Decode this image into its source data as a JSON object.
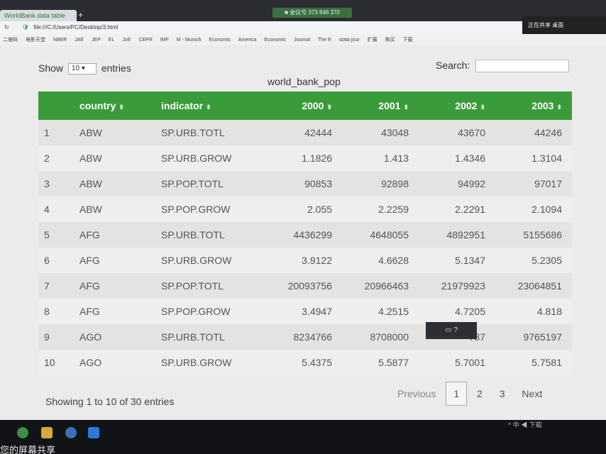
{
  "browser": {
    "tab_label": "WorldBank data table",
    "new_tab": "+",
    "monitor_text": "■ 会议号 373 846 370",
    "share_popup": "正在共享 桌面",
    "address": "file:///C:/Users/PC/Desktop/3.html",
    "bookmarks": [
      "二维码",
      "电影天堂",
      "NBER",
      "JAE",
      "JEP",
      "EL",
      "JoE",
      "CEPR",
      "IMF",
      "M - Munich",
      "Economic",
      "America",
      "Economic",
      "Journal",
      "The R",
      "stata jour",
      "扩展",
      "购买",
      "下载"
    ]
  },
  "table_page": {
    "show_label": "Show",
    "entries_select_value": "10",
    "entries_label": "entries",
    "search_label": "Search:",
    "search_value": "",
    "caption": "world_bank_pop",
    "columns": [
      "",
      "country",
      "indicator",
      "2000",
      "2001",
      "2002",
      "2003"
    ],
    "rows": [
      [
        "1",
        "ABW",
        "SP.URB.TOTL",
        "42444",
        "43048",
        "43670",
        "44246"
      ],
      [
        "2",
        "ABW",
        "SP.URB.GROW",
        "1.1826",
        "1.413",
        "1.4346",
        "1.3104"
      ],
      [
        "3",
        "ABW",
        "SP.POP.TOTL",
        "90853",
        "92898",
        "94992",
        "97017"
      ],
      [
        "4",
        "ABW",
        "SP.POP.GROW",
        "2.055",
        "2.2259",
        "2.2291",
        "2.1094"
      ],
      [
        "5",
        "AFG",
        "SP.URB.TOTL",
        "4436299",
        "4648055",
        "4892951",
        "5155686"
      ],
      [
        "6",
        "AFG",
        "SP.URB.GROW",
        "3.9122",
        "4.6628",
        "5.1347",
        "5.2305"
      ],
      [
        "7",
        "AFG",
        "SP.POP.TOTL",
        "20093756",
        "20966463",
        "21979923",
        "23064851"
      ],
      [
        "8",
        "AFG",
        "SP.POP.GROW",
        "3.4947",
        "4.2515",
        "4.7205",
        "4.818"
      ],
      [
        "9",
        "AGO",
        "SP.URB.TOTL",
        "8234766",
        "8708000",
        "787",
        "9765197"
      ],
      [
        "10",
        "AGO",
        "SP.URB.GROW",
        "5.4375",
        "5.5877",
        "5.7001",
        "5.7581"
      ]
    ],
    "info": "Showing 1 to 10 of 30 entries",
    "pagination": {
      "previous": "Previous",
      "pages": [
        "1",
        "2",
        "3"
      ],
      "current": "1",
      "next": "Next"
    }
  },
  "taskbar": {
    "bottom_caption": "您的屏幕共享",
    "tray_text": "^ 中 ◀ 下载"
  },
  "icons": {
    "sort": "⬍",
    "shield": "🛡"
  }
}
